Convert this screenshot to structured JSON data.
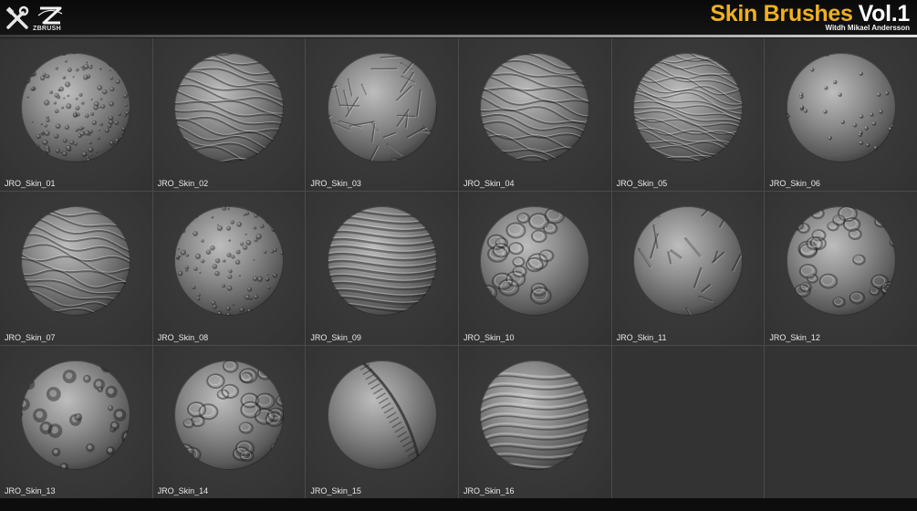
{
  "header": {
    "title_main": "Skin Brushes",
    "title_vol": "Vol.1",
    "subtitle": "Witdh Mikael Andersson",
    "logo_text": "ZBRUSH",
    "title_color": "#f0b020"
  },
  "brushes": [
    {
      "label": "JRO_Skin_01",
      "pattern": "pores"
    },
    {
      "label": "JRO_Skin_02",
      "pattern": "waves"
    },
    {
      "label": "JRO_Skin_03",
      "pattern": "cracks"
    },
    {
      "label": "JRO_Skin_04",
      "pattern": "waves"
    },
    {
      "label": "JRO_Skin_05",
      "pattern": "fine-waves"
    },
    {
      "label": "JRO_Skin_06",
      "pattern": "bumps"
    },
    {
      "label": "JRO_Skin_07",
      "pattern": "wrinkles"
    },
    {
      "label": "JRO_Skin_08",
      "pattern": "dots"
    },
    {
      "label": "JRO_Skin_09",
      "pattern": "folds"
    },
    {
      "label": "JRO_Skin_10",
      "pattern": "cells"
    },
    {
      "label": "JRO_Skin_11",
      "pattern": "facets"
    },
    {
      "label": "JRO_Skin_12",
      "pattern": "veins"
    },
    {
      "label": "JRO_Skin_13",
      "pattern": "dents"
    },
    {
      "label": "JRO_Skin_14",
      "pattern": "veins"
    },
    {
      "label": "JRO_Skin_15",
      "pattern": "seam"
    },
    {
      "label": "JRO_Skin_16",
      "pattern": "swirl"
    }
  ]
}
